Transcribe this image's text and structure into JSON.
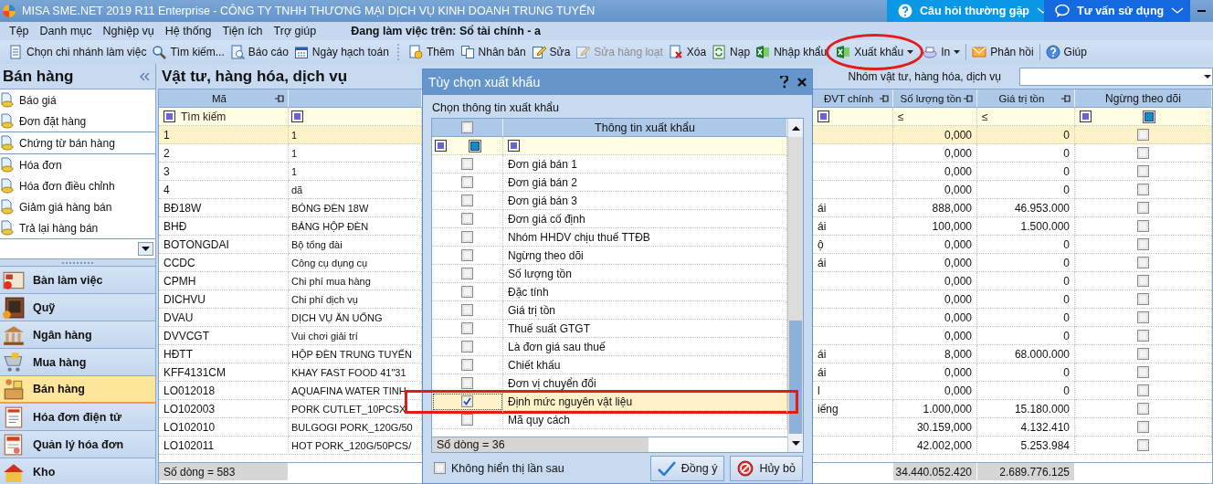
{
  "window": {
    "title": "MISA SME.NET 2019 R11 Enterprise - CÔNG TY TNHH THƯƠNG MẠI DỊCH VỤ KINH DOANH TRUNG TUYẾN"
  },
  "help_tabs": [
    {
      "label": "Câu hỏi thường gặp",
      "kind": "faq"
    },
    {
      "label": "Tư vấn sử dụng",
      "kind": "chat"
    }
  ],
  "menu": [
    "Tệp",
    "Danh mục",
    "Nghiệp vụ",
    "Hệ thống",
    "Tiện ích",
    "Trợ giúp"
  ],
  "workspace": "Đang làm việc trên: Sổ tài chính - a",
  "toolbar": [
    [
      {
        "label": "Chọn chi nhánh làm việc",
        "kind": "list",
        "disabled": false,
        "dropdown": false,
        "circled": false
      },
      {
        "label": "Tìm kiếm...",
        "kind": "search",
        "disabled": false,
        "dropdown": false,
        "circled": false
      },
      {
        "label": "Báo cáo",
        "kind": "report",
        "disabled": false,
        "dropdown": false,
        "circled": false
      },
      {
        "label": "Ngày hạch toán",
        "kind": "calendar",
        "disabled": false,
        "dropdown": false,
        "circled": false
      }
    ],
    [
      {
        "label": "Thêm",
        "kind": "add",
        "disabled": false,
        "dropdown": false,
        "circled": false
      },
      {
        "label": "Nhân bản",
        "kind": "copy",
        "disabled": false,
        "dropdown": false,
        "circled": false
      },
      {
        "label": "Sửa",
        "kind": "edit",
        "disabled": false,
        "dropdown": false,
        "circled": false
      },
      {
        "label": "Sửa hàng loạt",
        "kind": "edit",
        "disabled": true,
        "dropdown": false,
        "circled": false
      },
      {
        "label": "Xóa",
        "kind": "delete",
        "disabled": false,
        "dropdown": false,
        "circled": false
      },
      {
        "label": "Nạp",
        "kind": "reload",
        "disabled": false,
        "dropdown": false,
        "circled": false
      },
      {
        "label": "Nhập khẩu",
        "kind": "sheet",
        "disabled": false,
        "dropdown": false,
        "circled": false
      },
      {
        "label": "Xuất khẩu",
        "kind": "sheet",
        "disabled": false,
        "dropdown": true,
        "circled": true
      },
      {
        "label": "In",
        "kind": "print",
        "disabled": false,
        "dropdown": true,
        "circled": false
      }
    ],
    [
      {
        "label": "Phản hồi",
        "kind": "mail",
        "disabled": false,
        "dropdown": false,
        "circled": false
      }
    ],
    [
      {
        "label": "Giúp",
        "kind": "help",
        "disabled": false,
        "dropdown": false,
        "circled": false
      }
    ]
  ],
  "sidebar": {
    "title": "Bán hàng",
    "groups": [
      [
        "Báo giá",
        "Đơn đặt hàng"
      ],
      [
        "Chứng từ bán hàng"
      ],
      [
        "Hóa đơn",
        "Hóa đơn điều chỉnh",
        "Giảm giá hàng bán",
        "Trả lại hàng bán"
      ]
    ],
    "modules": [
      {
        "label": "Bàn làm việc",
        "kind": "desk",
        "selected": false
      },
      {
        "label": "Quỹ",
        "kind": "safe",
        "selected": false
      },
      {
        "label": "Ngân hàng",
        "kind": "bank",
        "selected": false
      },
      {
        "label": "Mua hàng",
        "kind": "cart",
        "selected": false
      },
      {
        "label": "Bán hàng",
        "kind": "sales",
        "selected": true
      },
      {
        "label": "Hóa đơn điện tử",
        "kind": "einvoice",
        "selected": false
      },
      {
        "label": "Quản lý hóa đơn",
        "kind": "invoice",
        "selected": false
      },
      {
        "label": "Kho",
        "kind": "store",
        "selected": false
      }
    ]
  },
  "table": {
    "title": "Vật tư, hàng hóa, dịch vụ",
    "group_filter": {
      "label": "Nhóm vật tư, hàng hóa, dịch vụ"
    },
    "columns": [
      {
        "label": "Mã",
        "pin": true,
        "filter": {
          "kind": "search",
          "placeholder": "Tìm kiếm"
        }
      },
      {
        "pin": false,
        "filter": {
          "kind": "square"
        }
      },
      {
        "label": "ĐVT chính",
        "pin": true,
        "filter": {
          "kind": "square"
        }
      },
      {
        "label": "Số lượng tồn",
        "pin": true,
        "filter": {
          "kind": "operator",
          "text": "≤"
        }
      },
      {
        "label": "Giá trị tồn",
        "pin": true,
        "filter": {
          "kind": "operator",
          "text": "≤"
        }
      },
      {
        "label": "Ngừng theo dõi",
        "pin": false,
        "filter": {
          "kind": "checkbox"
        }
      }
    ],
    "rows": [
      {
        "code": "1",
        "name": "1",
        "qty": "0,000",
        "value": "0",
        "stopped": false,
        "selected": true
      },
      {
        "code": "2",
        "name": "1",
        "qty": "0,000",
        "value": "0",
        "stopped": false,
        "selected": false
      },
      {
        "code": "3",
        "name": "1",
        "qty": "0,000",
        "value": "0",
        "stopped": false,
        "selected": false
      },
      {
        "code": "4",
        "name": "dã",
        "qty": "0,000",
        "value": "0",
        "stopped": false,
        "selected": false
      },
      {
        "code": "BĐ18W",
        "name": "BÓNG ĐÈN 18W",
        "unit": "ái",
        "qty": "888,000",
        "value": "46.953.000",
        "stopped": false,
        "selected": false
      },
      {
        "code": "BHĐ",
        "name": "BẢNG HỘP ĐÈN",
        "unit": "ái",
        "qty": "100,000",
        "value": "1.500.000",
        "stopped": false,
        "selected": false
      },
      {
        "code": "BOTONGDAI",
        "name": "Bộ tổng đài",
        "unit": "ộ",
        "qty": "0,000",
        "value": "0",
        "stopped": false,
        "selected": false
      },
      {
        "code": "CCDC",
        "name": "Công cụ dụng cụ",
        "unit": "ái",
        "qty": "0,000",
        "value": "0",
        "stopped": false,
        "selected": false
      },
      {
        "code": "CPMH",
        "name": "Chi phí mua hàng",
        "qty": "0,000",
        "value": "0",
        "stopped": false,
        "selected": false
      },
      {
        "code": "DICHVU",
        "name": "Chi phí dịch vụ",
        "qty": "0,000",
        "value": "0",
        "stopped": false,
        "selected": false
      },
      {
        "code": "DVAU",
        "name": "DỊCH VỤ ĂN UỐNG",
        "qty": "0,000",
        "value": "0",
        "stopped": false,
        "selected": false
      },
      {
        "code": "DVVCGT",
        "name": "Vui chơi giải trí",
        "qty": "0,000",
        "value": "0",
        "stopped": false,
        "selected": false
      },
      {
        "code": "HĐTT",
        "name": "HỘP ĐÈN TRUNG TUYẾN",
        "unit": "ái",
        "qty": "8,000",
        "value": "68.000.000",
        "stopped": false,
        "selected": false
      },
      {
        "code": "KFF4131CM",
        "name": "KHAY FAST FOOD 41\"31",
        "unit": "ái",
        "qty": "0,000",
        "value": "0",
        "stopped": false,
        "selected": false
      },
      {
        "code": "LO012018",
        "name": "AQUAFINA WATER TINH",
        "unit": "l",
        "qty": "0,000",
        "value": "0",
        "stopped": false,
        "selected": false
      },
      {
        "code": "LO102003",
        "name": "PORK CUTLET_10PCSX",
        "unit": "iếng",
        "qty": "1.000,000",
        "value": "15.180.000",
        "stopped": false,
        "selected": false
      },
      {
        "code": "LO102010",
        "name": "BULGOGI PORK_120G/50",
        "qty": "30.159,000",
        "value": "4.132.410",
        "stopped": false,
        "selected": false
      },
      {
        "code": "LO102011",
        "name": "HOT PORK_120G/50PCS/",
        "qty": "42.002,000",
        "value": "5.253.984",
        "stopped": false,
        "selected": false
      }
    ],
    "footer": {
      "count": "Số dòng = 583",
      "qty_total": "34.440.052.420",
      "value_total": "2.689.776.125"
    }
  },
  "dialog": {
    "title": "Tùy chọn xuất khẩu",
    "prompt": "Chọn thông tin xuất khẩu",
    "column": "Thông tin xuất khẩu",
    "select_all_checked": false,
    "rows": [
      {
        "label": "Đơn giá bán 1",
        "checked": false,
        "selected": false,
        "framed": false
      },
      {
        "label": "Đơn giá bán 2",
        "checked": false,
        "selected": false,
        "framed": false
      },
      {
        "label": "Đơn giá bán 3",
        "checked": false,
        "selected": false,
        "framed": false
      },
      {
        "label": "Đơn giá cố định",
        "checked": false,
        "selected": false,
        "framed": false
      },
      {
        "label": "Nhóm HHDV chịu thuế TTĐB",
        "checked": false,
        "selected": false,
        "framed": false
      },
      {
        "label": "Ngừng theo dõi",
        "checked": false,
        "selected": false,
        "framed": false
      },
      {
        "label": "Số lượng tồn",
        "checked": false,
        "selected": false,
        "framed": false
      },
      {
        "label": "Đặc tính",
        "checked": false,
        "selected": false,
        "framed": false
      },
      {
        "label": "Giá trị tồn",
        "checked": false,
        "selected": false,
        "framed": false
      },
      {
        "label": "Thuế suất GTGT",
        "checked": false,
        "selected": false,
        "framed": false
      },
      {
        "label": "Là đơn giá sau thuế",
        "checked": false,
        "selected": false,
        "framed": false
      },
      {
        "label": "Chiết khấu",
        "checked": false,
        "selected": false,
        "framed": false
      },
      {
        "label": "Đơn vị chuyển đổi",
        "checked": false,
        "selected": false,
        "framed": false
      },
      {
        "label": "Định mức nguyên vật liệu",
        "checked": true,
        "selected": true,
        "framed": true
      },
      {
        "label": "Mã quy cách",
        "checked": false,
        "selected": false,
        "framed": false
      }
    ],
    "count": "Số dòng = 36",
    "dont_show": {
      "label": "Không hiển thị lần sau",
      "checked": false
    },
    "buttons": [
      {
        "label": "Đồng ý",
        "kind": "ok"
      },
      {
        "label": "Hủy bỏ",
        "kind": "cancel"
      }
    ]
  }
}
